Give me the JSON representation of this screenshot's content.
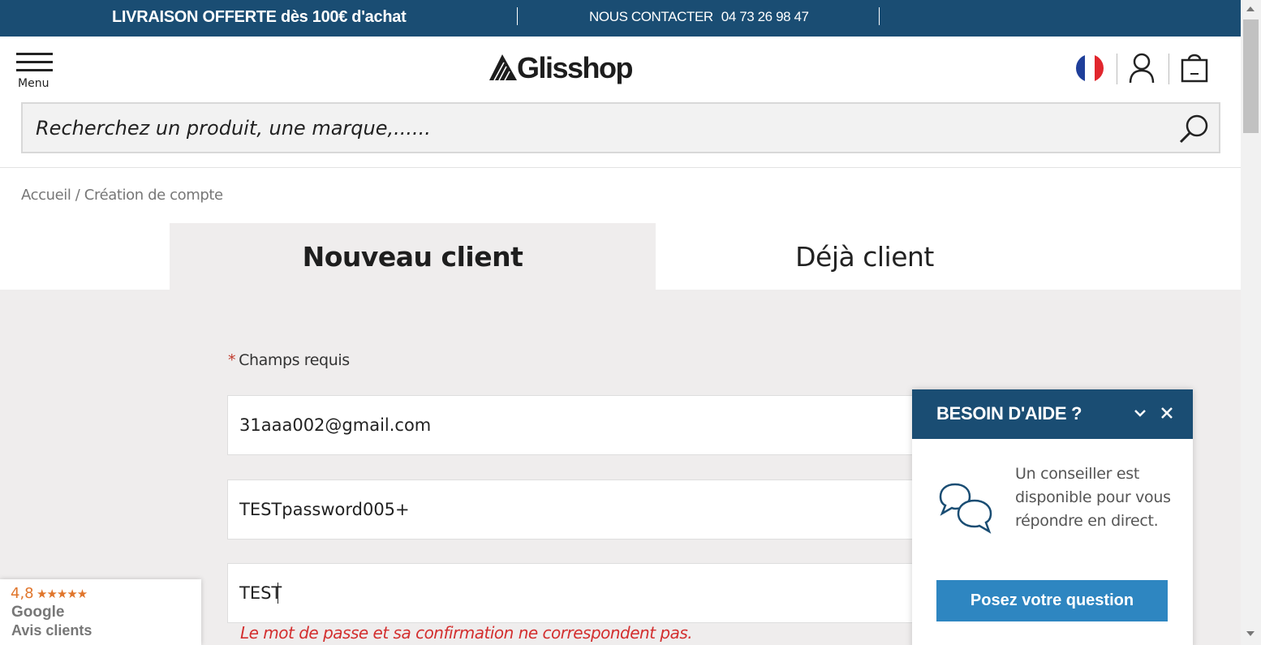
{
  "topbar": {
    "promo": "LIVRAISON OFFERTE dès 100€ d'achat",
    "contact_label": "NOUS CONTACTER",
    "contact_phone": "04 73 26 98 47"
  },
  "header": {
    "menu_label": "Menu",
    "logo_text": "Glisshop",
    "flag_colors": [
      "#1f3f9a",
      "#ffffff",
      "#e1262d"
    ]
  },
  "search": {
    "placeholder": "Recherchez un produit, une marque,......"
  },
  "breadcrumb": {
    "home": "Accueil",
    "separator": " / ",
    "current": "Création de compte"
  },
  "tabs": {
    "new_client": "Nouveau client",
    "existing_client": "Déjà client"
  },
  "form": {
    "required_star": "*",
    "required_label": "Champs requis",
    "email_value": "31aaa002@gmail.com",
    "password_value": "TESTpassword005+",
    "confirm_value": "TEST",
    "error_message": "Le mot de passe et sa confirmation ne correspondent pas."
  },
  "help": {
    "title": "BESOIN D'AIDE ?",
    "message": "Un conseiller est disponible pour vous répondre en direct.",
    "button_label": "Posez votre question"
  },
  "google_badge": {
    "rating": "4,8",
    "stars": "★★★★★",
    "brand": "Google",
    "label": "Avis clients"
  },
  "colors": {
    "brand_blue": "#1a4d73",
    "button_blue": "#2e86c1",
    "error_red": "#d32f2f",
    "star_orange": "#e0752b"
  }
}
